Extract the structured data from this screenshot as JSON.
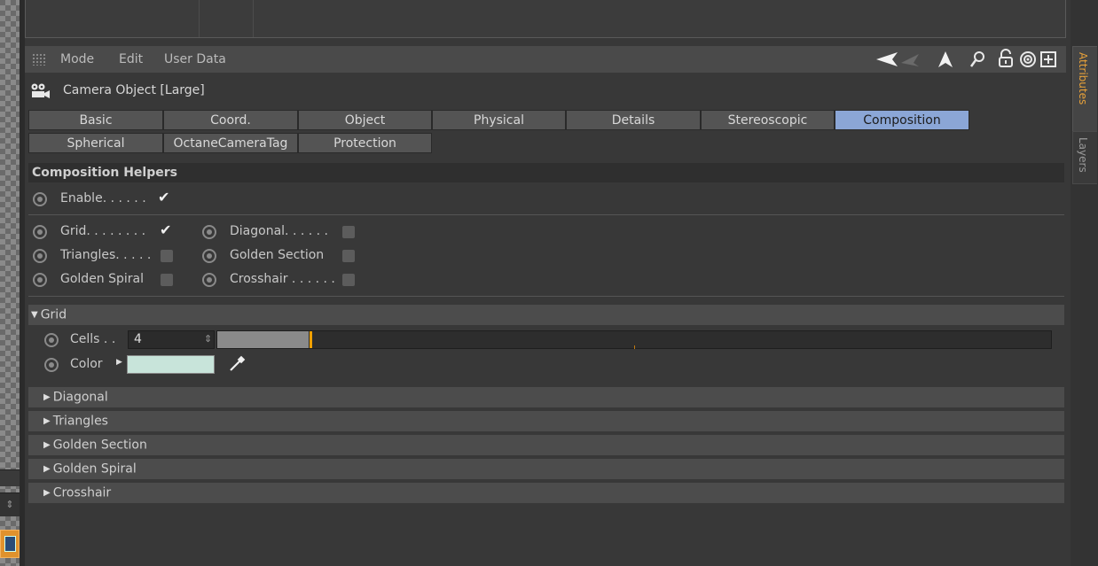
{
  "menubar": {
    "items": [
      "Mode",
      "Edit",
      "User Data"
    ],
    "icons": [
      "grip-icon",
      "back-arrow-icon",
      "forward-arrow-icon",
      "up-arrow-icon",
      "search-icon",
      "lock-icon",
      "target-icon",
      "new-panel-icon"
    ]
  },
  "object": {
    "icon": "camera-icon",
    "title": "Camera Object [Large]"
  },
  "tabs": {
    "row1": [
      "Basic",
      "Coord.",
      "Object",
      "Physical",
      "Details",
      "Stereoscopic",
      "Composition"
    ],
    "row2": [
      "Spherical",
      "OctaneCameraTag",
      "Protection"
    ],
    "active": "Composition"
  },
  "section": {
    "title": "Composition Helpers"
  },
  "params": {
    "enable": {
      "label": "Enable. . . . . .",
      "checked": true
    },
    "grid": {
      "label": "Grid. . . . . . . .",
      "checked": true
    },
    "diagonal": {
      "label": "Diagonal. . . . . .",
      "checked": false
    },
    "triangles": {
      "label": "Triangles. . . . .",
      "checked": false
    },
    "golden_section": {
      "label": "Golden Section",
      "checked": false
    },
    "golden_spiral": {
      "label": "Golden Spiral",
      "checked": false
    },
    "crosshair": {
      "label": "Crosshair . . . . . .",
      "checked": false
    }
  },
  "grid_group": {
    "title": "Grid",
    "cells_label": "Cells . .",
    "cells_value": "4",
    "cells_slider_fraction": 0.11,
    "color_label": "Color",
    "color_value": "#c8e4da"
  },
  "collapsed_groups": [
    "Diagonal",
    "Triangles",
    "Golden Section",
    "Golden Spiral",
    "Crosshair"
  ],
  "side_tabs": {
    "attributes": "Attributes",
    "layers": "Layers"
  },
  "colors": {
    "accent_tab": "#8ba6d6",
    "attributes_tab_text": "#e8a13a",
    "slider_handle": "#f0a000"
  }
}
